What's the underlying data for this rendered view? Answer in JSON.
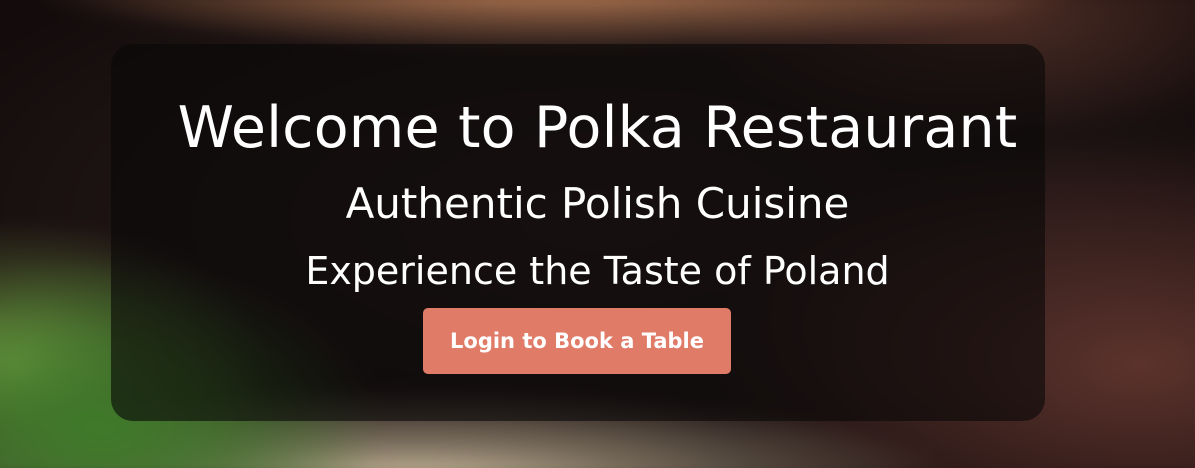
{
  "hero": {
    "title": "Welcome to Polka Restaurant",
    "subtitle": "Authentic Polish Cuisine",
    "tagline": "Experience the Taste of Poland",
    "cta_label": "Login to Book a Table"
  },
  "colors": {
    "cta_background": "#e07b68",
    "text": "#ffffff",
    "overlay": "rgba(10,8,8,0.62)"
  }
}
